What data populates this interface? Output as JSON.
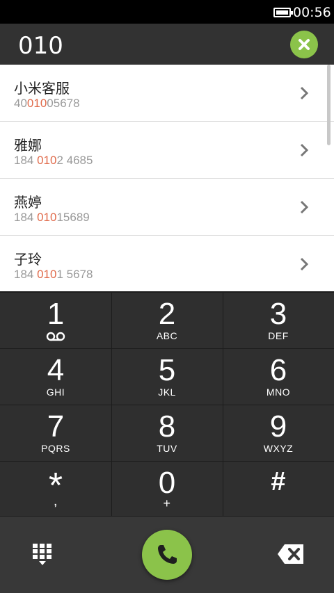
{
  "status": {
    "time": "00:56",
    "battery_icon": "battery-icon"
  },
  "dialer": {
    "number": "010",
    "clear_icon": "close-icon"
  },
  "matches": [
    {
      "name": "小米客服",
      "num_pre": "40",
      "num_hl": "010",
      "num_post": "05678"
    },
    {
      "name": "雅娜",
      "num_pre": "184 ",
      "num_hl": "010",
      "num_post": "2 4685"
    },
    {
      "name": "燕婷",
      "num_pre": "184 ",
      "num_hl": "010",
      "num_post": "15689"
    },
    {
      "name": "子玲",
      "num_pre": "184 ",
      "num_hl": "010",
      "num_post": "1 5678"
    }
  ],
  "keypad": {
    "keys": [
      {
        "digit": "1",
        "letters": ""
      },
      {
        "digit": "2",
        "letters": "ABC"
      },
      {
        "digit": "3",
        "letters": "DEF"
      },
      {
        "digit": "4",
        "letters": "GHI"
      },
      {
        "digit": "5",
        "letters": "JKL"
      },
      {
        "digit": "6",
        "letters": "MNO"
      },
      {
        "digit": "7",
        "letters": "PQRS"
      },
      {
        "digit": "8",
        "letters": "TUV"
      },
      {
        "digit": "9",
        "letters": "WXYZ"
      },
      {
        "digit": "*",
        "letters": ","
      },
      {
        "digit": "0",
        "letters": "+"
      },
      {
        "digit": "#",
        "letters": ""
      }
    ]
  },
  "bottom": {
    "keypad_icon": "keypad-grid-icon",
    "call_icon": "phone-icon",
    "backspace_icon": "backspace-icon"
  },
  "colors": {
    "accent": "#8bc34a",
    "highlight": "#e06a4a",
    "keypad_bg": "#2f2f2f",
    "header_bg": "#323232"
  }
}
